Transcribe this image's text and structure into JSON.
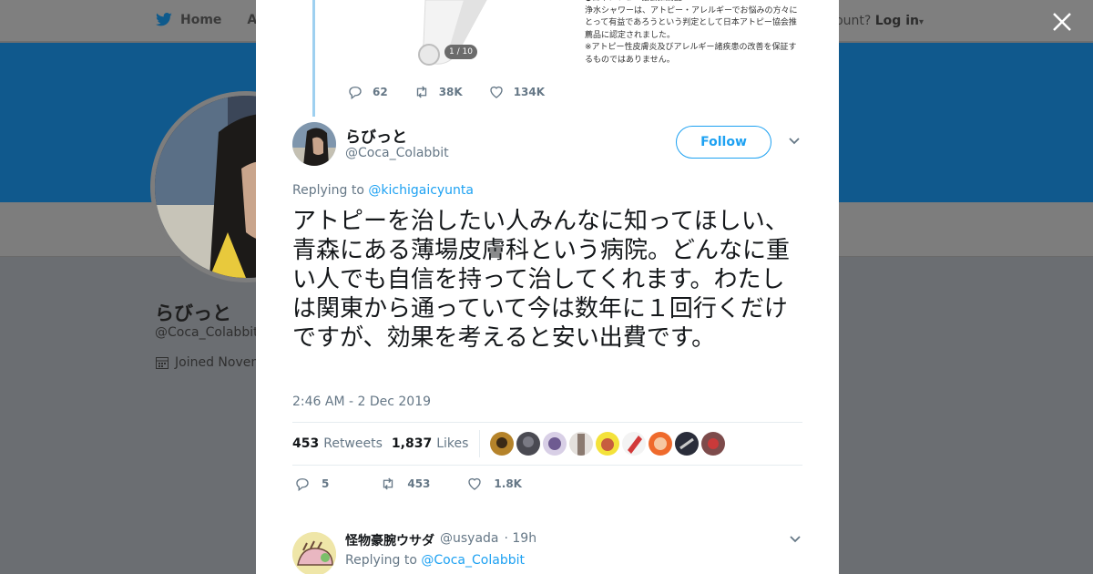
{
  "background": {
    "nav": {
      "home": "Home",
      "about": "Abo"
    },
    "account_prompt": "ccount?",
    "login": "Log in",
    "profile_name": "らびっと",
    "profile_handle": "@Coca_Colabbit",
    "joined": "Joined Novem"
  },
  "close_icon": "close-icon",
  "quoted": {
    "image_counter": "1 / 10",
    "image_text": "●日本アトピー協会推薦品\n浄水シャワーは、アトピー・アレルギーでお悩みの方々にとって有益であろうという判定として日本アトピー協会推薦品に認定されました。\n※アトピー性皮膚炎及びアレルギー諸疾患の改善を保証するものではありません。",
    "replies": "62",
    "retweets": "38K",
    "likes": "134K"
  },
  "tweet": {
    "author_name": "らびっと",
    "author_handle": "@Coca_Colabbit",
    "follow_label": "Follow",
    "replying_label": "Replying to",
    "replying_to": "@kichigaicyunta",
    "text": "アトピーを治したい人みんなに知ってほしい、青森にある薄場皮膚科という病院。どんなに重い人でも自信を持って治してくれます。わたしは関東から通っていて今は数年に１回行くだけですが、効果を考えると安い出費です。",
    "timestamp": "2:46 AM - 2 Dec 2019",
    "retweet_count": "453",
    "retweet_label": "Retweets",
    "like_count": "1,837",
    "like_label": "Likes",
    "replies": "5",
    "retweets": "453",
    "likes": "1.8K"
  },
  "reply": {
    "name": "怪物豪腕ウサダ",
    "handle": "@usyada",
    "time": "· 19h",
    "replying_label": "Replying to",
    "replying_to": "@Coca_Colabbit"
  },
  "colors": {
    "link": "#1da1f2",
    "muted": "#657786",
    "text": "#14171a",
    "banner": "#10598d",
    "thread": "#9ed0f0"
  }
}
